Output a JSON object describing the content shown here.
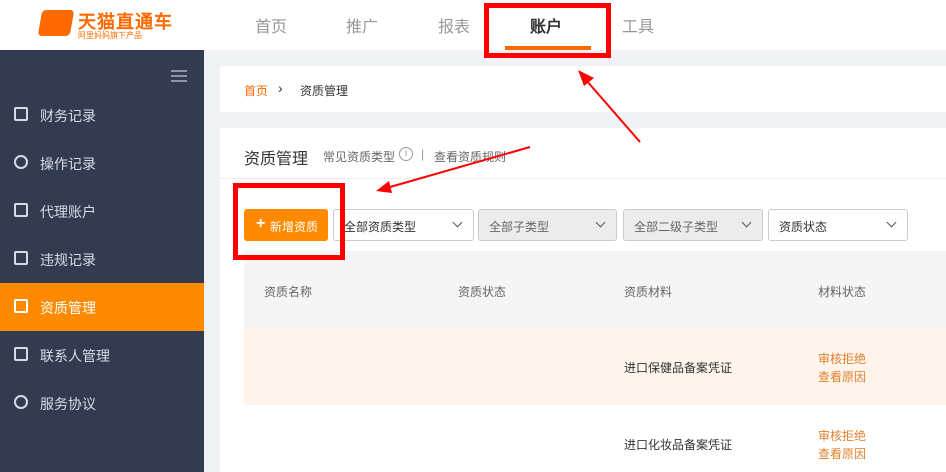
{
  "app": {
    "title": "天猫直通车",
    "subtitle": "阿里妈妈旗下产品"
  },
  "nav": [
    {
      "label": "首页"
    },
    {
      "label": "推广"
    },
    {
      "label": "报表"
    },
    {
      "label": "账户"
    },
    {
      "label": "工具"
    }
  ],
  "sidebar": {
    "items": [
      {
        "label": "财务记录"
      },
      {
        "label": "操作记录"
      },
      {
        "label": "代理账户"
      },
      {
        "label": "违规记录"
      },
      {
        "label": "资质管理"
      },
      {
        "label": "联系人管理"
      },
      {
        "label": "服务协议"
      }
    ]
  },
  "breadcrumb": {
    "home": "首页",
    "current": "资质管理"
  },
  "page": {
    "title": "资质管理",
    "link_types": "常见资质类型",
    "link_rules": "查看资质规则"
  },
  "toolbar": {
    "add_label": "新增资质"
  },
  "filters": [
    {
      "label": "全部资质类型"
    },
    {
      "label": "全部子类型"
    },
    {
      "label": "全部二级子类型"
    },
    {
      "label": "资质状态"
    }
  ],
  "table": {
    "headers": [
      "资质名称",
      "资质状态",
      "资质材料",
      "材料状态"
    ],
    "rows": [
      {
        "material": "进口保健品备案凭证",
        "status_line1": "审核拒绝",
        "status_line2": "查看原因"
      },
      {
        "material": "进口化妆品备案凭证",
        "status_line1": "审核拒绝",
        "status_line2": "查看原因"
      }
    ]
  },
  "colors": {
    "accent": "#ff8a00",
    "sidebar_bg": "#333b50",
    "annotation": "#ff0000"
  }
}
